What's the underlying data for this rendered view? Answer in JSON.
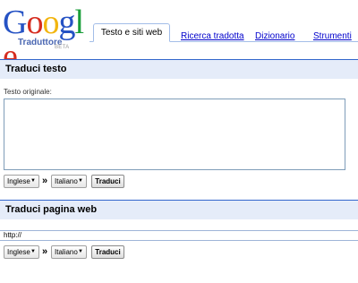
{
  "logo": {
    "letters": [
      {
        "ch": "G",
        "color": "#2552c4"
      },
      {
        "ch": "o",
        "color": "#d62d20"
      },
      {
        "ch": "o",
        "color": "#f2b50f"
      },
      {
        "ch": "g",
        "color": "#2552c4"
      },
      {
        "ch": "l",
        "color": "#1a9e3a"
      },
      {
        "ch": "e",
        "color": "#d62d20"
      }
    ],
    "subtitle": "Traduttore",
    "beta": "BETA"
  },
  "tabs": {
    "active": "Testo e siti web",
    "items": [
      "Ricerca tradotta",
      "Dizionario",
      "Strumenti"
    ]
  },
  "text_section": {
    "title": "Traduci testo",
    "label": "Testo originale:",
    "textarea_value": "",
    "source_lang": "Inglese",
    "target_lang": "Italiano",
    "arrows": "»",
    "button": "Traduci"
  },
  "web_section": {
    "title": "Traduci pagina web",
    "url_value": "http://",
    "source_lang": "Inglese",
    "target_lang": "Italiano",
    "arrows": "»",
    "button": "Traduci"
  },
  "colors": {
    "accent_line": "#3366cc",
    "section_bg": "#e5ecf9",
    "link": "#0000cc"
  },
  "icons": {
    "dropdown": "chevron-down-icon"
  }
}
